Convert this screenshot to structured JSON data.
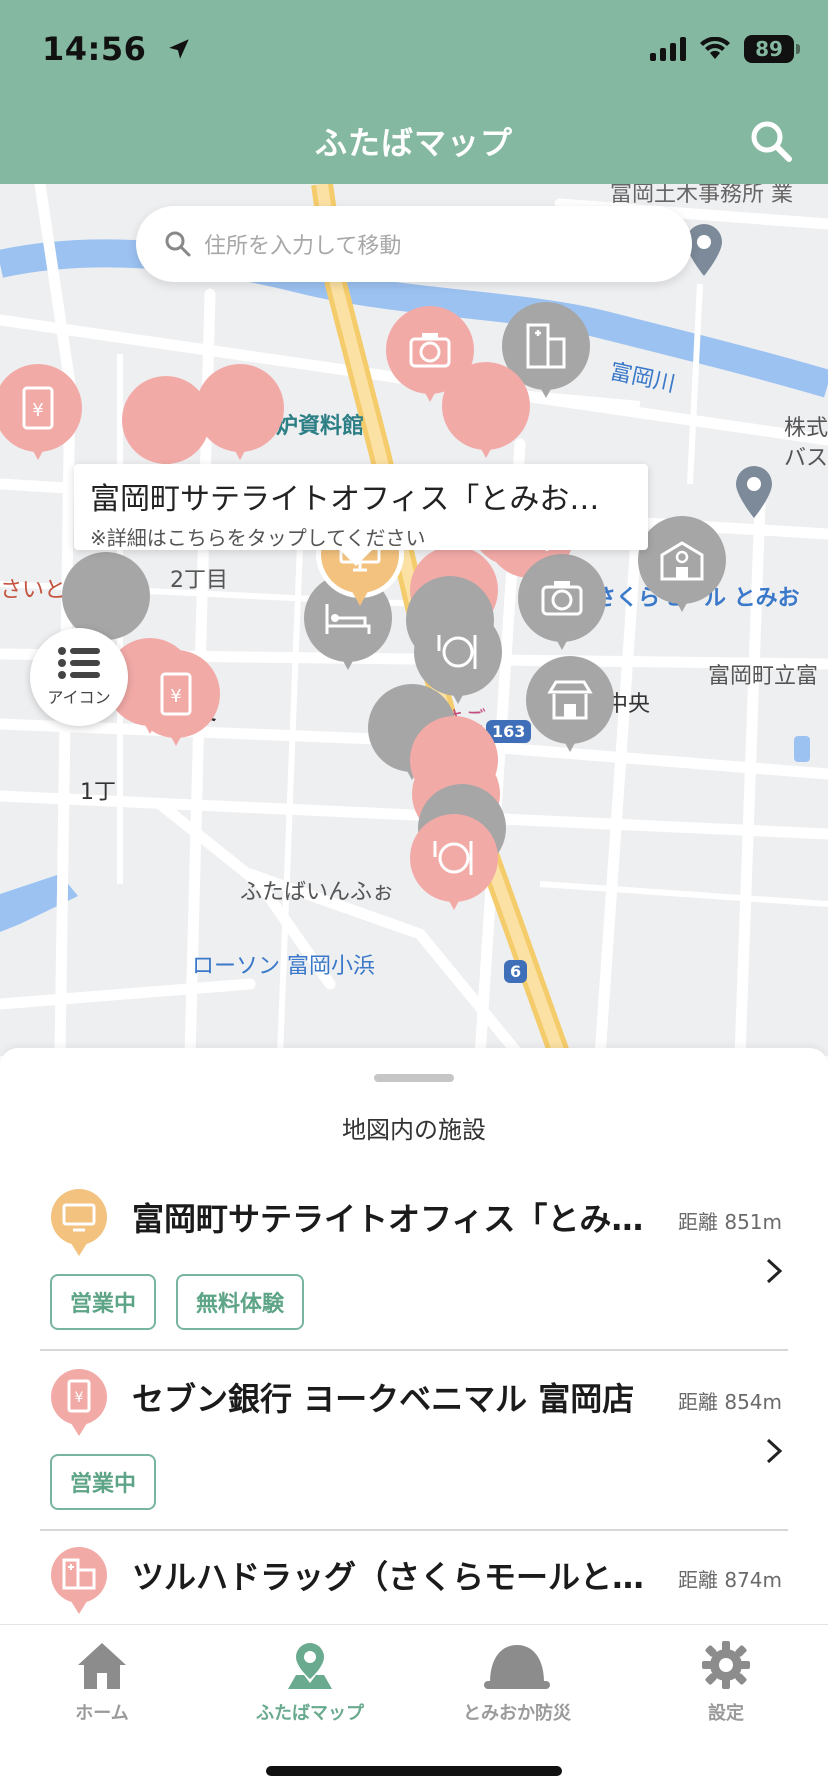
{
  "status": {
    "time": "14:56",
    "battery": "89"
  },
  "header": {
    "title": "ふたばマップ"
  },
  "search": {
    "placeholder": "住所を入力して移動"
  },
  "map": {
    "labels": [
      "富岡土木事務所 業",
      "富岡川",
      "東京電力廃炉資料館",
      "株式",
      "バス",
      "さいとう眼科",
      "2丁目",
      "さくらモール とみお",
      "富岡町立富",
      "中央",
      "中央",
      "1丁",
      "ホテルさご",
      "ふたばいんふぉ",
      "ローソン 富岡小浜",
      "163",
      "6"
    ],
    "callout": {
      "title": "富岡町サテライトオフィス「とみお…",
      "note": "※詳細はこちらをタップしてください"
    },
    "icon_button_label": "アイコン"
  },
  "sheet": {
    "title": "地図内の施設",
    "facilities": [
      {
        "name": "富岡町サテライトオフィス「とみ…",
        "distance": "距離 851m",
        "tags": [
          "営業中",
          "無料体験"
        ],
        "icon": "monitor-icon",
        "color": "#f2c27e"
      },
      {
        "name": "セブン銀行 ヨークベニマル 富岡店",
        "distance": "距離 854m",
        "tags": [
          "営業中"
        ],
        "icon": "atm-icon",
        "color": "#f2aaa7"
      },
      {
        "name": "ツルハドラッグ（さくらモールと…",
        "distance": "距離 874m",
        "tags": [],
        "icon": "drugstore-icon",
        "color": "#f2aaa7"
      }
    ]
  },
  "tabs": [
    {
      "label": "ホーム",
      "icon": "home-icon"
    },
    {
      "label": "ふたばマップ",
      "icon": "map-pin-icon",
      "active": true
    },
    {
      "label": "とみおか防災",
      "icon": "helmet-icon"
    },
    {
      "label": "設定",
      "icon": "gear-icon"
    }
  ],
  "colors": {
    "header": "#85b8a0",
    "accent": "#6aaa8f",
    "pink_pin": "#f2aaa7",
    "gray_pin": "#a6a6a6",
    "orange_pin": "#f2c27e"
  }
}
